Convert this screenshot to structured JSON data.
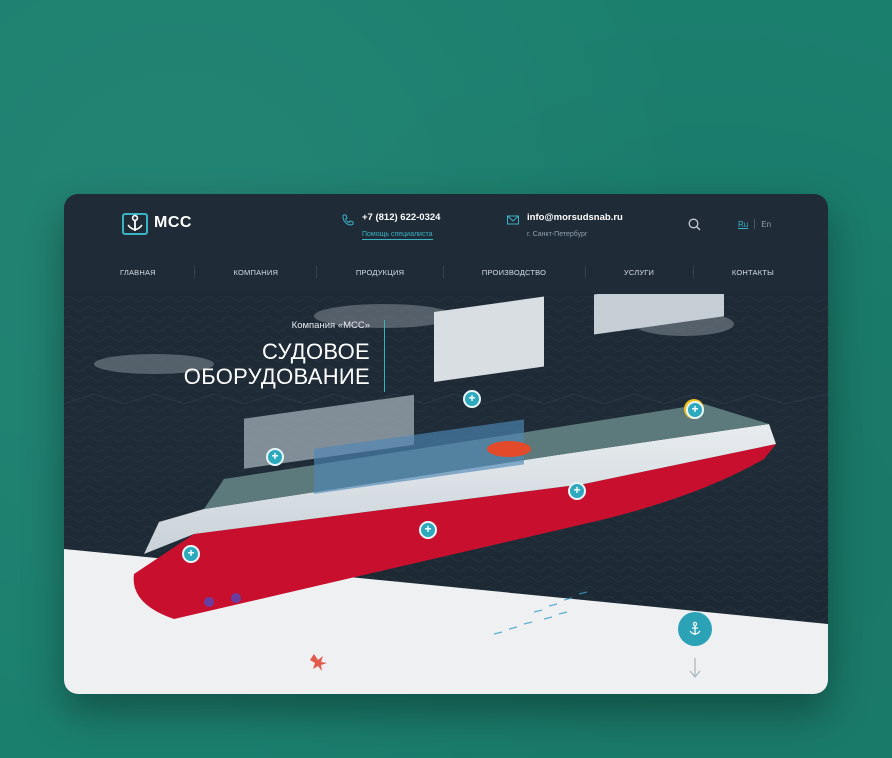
{
  "brand": {
    "name": "МСС",
    "accent": "#2da9bd",
    "background": "#1b7f6e",
    "panel": "#1f2b37"
  },
  "phone": {
    "number": "+7 (812) 622-0324",
    "link": "Помощь специалиста"
  },
  "email": {
    "address": "info@morsudsnab.ru",
    "city": "г. Санкт-Петербург"
  },
  "lang": {
    "ru": "Ru",
    "en": "En"
  },
  "nav": [
    "ГЛАВНАЯ",
    "КОМПАНИЯ",
    "ПРОДУКЦИЯ",
    "ПРОИЗВОДСТВО",
    "УСЛУГИ",
    "КОНТАКТЫ"
  ],
  "hero": {
    "subtitle": "Компания «МСС»",
    "title_line1": "СУДОВОЕ",
    "title_line2": "ОБОРУДОВАНИЕ"
  },
  "hotspots": [
    "+",
    "+",
    "+",
    "+",
    "+",
    "+"
  ],
  "icons": [
    "phone-icon",
    "mail-icon",
    "search-icon",
    "anchor-icon",
    "arrow-down-icon"
  ]
}
